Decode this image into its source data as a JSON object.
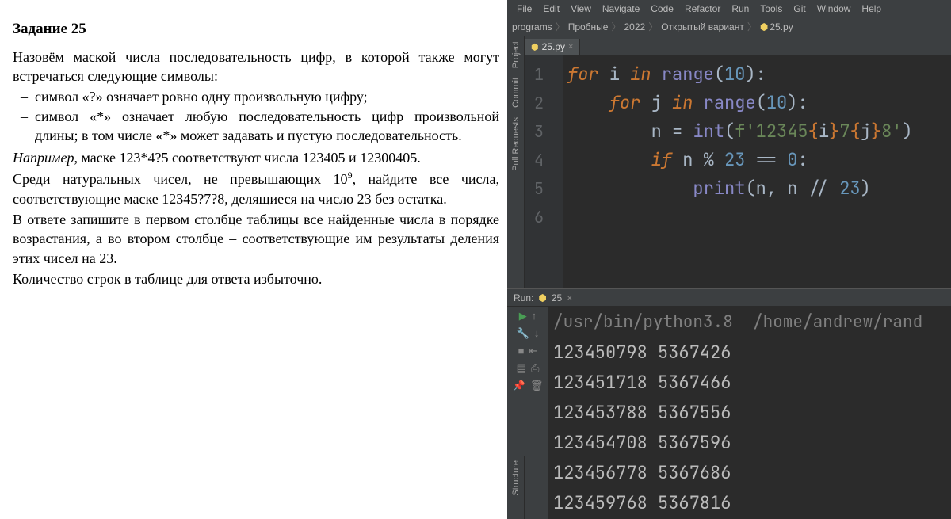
{
  "document": {
    "title": "Задание 25",
    "p1": "Назовём маской числа последовательность цифр, в которой также могут встречаться следующие символы:",
    "b1": "символ «?» означает ровно одну произвольную цифру;",
    "b2": "символ «*» означает любую последовательность цифр произвольной длины; в том числе «*» может задавать и пустую последовательность.",
    "p3a": "Например,",
    "p3b": " маске 123*4?5 соответствуют числа 123405 и 12300405.",
    "p4a": "Среди натуральных чисел, не превышающих 10",
    "p4sup": "9",
    "p4b": ", найдите все числа, соответствующие маске 12345?7?8, делящиеся на число 23 без остатка.",
    "p5": "В ответе запишите в первом столбце таблицы все найденные числа в порядке возрастания, а во втором столбце – соответствующие им результаты деления этих чисел на 23.",
    "p6": "Количество строк в таблице для ответа избыточно."
  },
  "ide": {
    "menu": [
      "File",
      "Edit",
      "View",
      "Navigate",
      "Code",
      "Refactor",
      "Run",
      "Tools",
      "Git",
      "Window",
      "Help"
    ],
    "breadcrumbs": [
      "programs",
      "Пробные",
      "2022",
      "Открытый вариант",
      "25.py"
    ],
    "tab_name": "25.py",
    "side": {
      "project": "Project",
      "commit": "Commit",
      "pull": "Pull Requests",
      "structure": "Structure"
    },
    "code": {
      "lines": [
        "1",
        "2",
        "3",
        "4",
        "5",
        "6"
      ],
      "l1": "for i in range(10):",
      "l2": "    for j in range(10):",
      "l3": "        n = int(f'12345{i}7{j}8')",
      "l4": "        if n % 23 == 0:",
      "l5": "            print(n, n // 23)"
    },
    "run": {
      "label": "Run:",
      "config": "25",
      "cmd": "/usr/bin/python3.8  /home/andrew/rand",
      "out": [
        "123450798 5367426",
        "123451718 5367466",
        "123453788 5367556",
        "123454708 5367596",
        "123456778 5367686",
        "123459768 5367816"
      ]
    }
  }
}
